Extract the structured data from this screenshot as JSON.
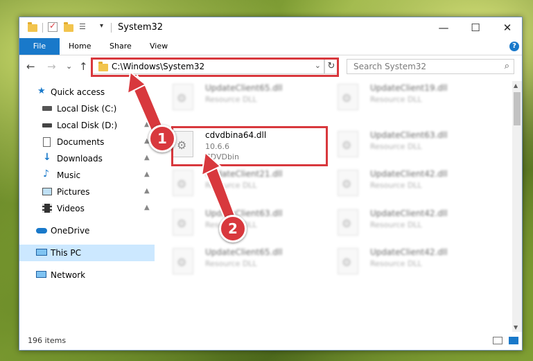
{
  "window": {
    "title": "System32",
    "minimize": "—",
    "maximize": "☐",
    "close": "✕"
  },
  "ribbon": {
    "file": "File",
    "home": "Home",
    "share": "Share",
    "view": "View",
    "help": "?"
  },
  "nav": {
    "back": "←",
    "forward": "→",
    "recent": "⌄",
    "up": "↑",
    "address": "C:\\Windows\\System32",
    "address_dropdown": "⌄",
    "refresh": "↻",
    "search_placeholder": "Search System32",
    "search_icon": "⌕"
  },
  "sidebar": {
    "items": [
      {
        "label": "Quick access",
        "icon": "star-icon",
        "pinned": false
      },
      {
        "label": "Local Disk (C:)",
        "icon": "drive-icon",
        "pinned": true
      },
      {
        "label": "Local Disk (D:)",
        "icon": "drive-icon",
        "pinned": true
      },
      {
        "label": "Documents",
        "icon": "document-icon",
        "pinned": true
      },
      {
        "label": "Downloads",
        "icon": "download-icon",
        "pinned": true
      },
      {
        "label": "Music",
        "icon": "music-icon",
        "pinned": true
      },
      {
        "label": "Pictures",
        "icon": "picture-icon",
        "pinned": true
      },
      {
        "label": "Videos",
        "icon": "video-icon",
        "pinned": true
      },
      {
        "label": "OneDrive",
        "icon": "cloud-icon",
        "pinned": false
      },
      {
        "label": "This PC",
        "icon": "computer-icon",
        "pinned": false,
        "selected": true
      },
      {
        "label": "Network",
        "icon": "network-icon",
        "pinned": false
      }
    ],
    "pin_glyph": "📌"
  },
  "files": {
    "highlighted": {
      "name": "cdvdbina64.dll",
      "version": "10.6.6",
      "desc": "CDVDbin"
    },
    "blurred": [
      {
        "name": "UpdateClient65.dll",
        "desc": "Resource DLL"
      },
      {
        "name": "UpdateClient19.dll",
        "desc": "Resource DLL"
      },
      {
        "name": "UpdateClient63.dll",
        "desc": "Resource DLL"
      },
      {
        "name": "UpdateClient21.dll",
        "desc": "Resource DLL"
      },
      {
        "name": "UpdateClient42.dll",
        "desc": "Resource DLL"
      },
      {
        "name": "UpdateClient63.dll",
        "desc": "Resource DLL"
      },
      {
        "name": "UpdateClient42.dll",
        "desc": "Resource DLL"
      },
      {
        "name": "UpdateClient65.dll",
        "desc": "Resource DLL"
      },
      {
        "name": "UpdateClient42.dll",
        "desc": "Resource DLL"
      }
    ],
    "gear_glyph": "⚙"
  },
  "status": {
    "items_count": "196 items"
  },
  "annotations": {
    "step1": "1",
    "step2": "2",
    "color": "#d8383d"
  },
  "colors": {
    "accent": "#1979ca",
    "selection": "#cce8ff",
    "highlight": "#d8383d"
  }
}
